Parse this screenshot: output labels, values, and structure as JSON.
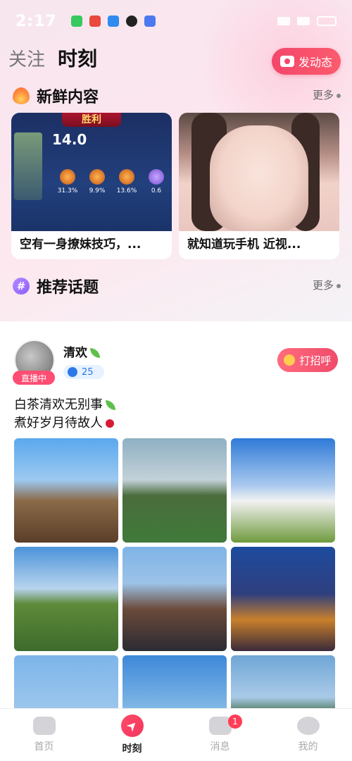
{
  "status_bar": {
    "time": "2:17"
  },
  "header": {
    "tabs": [
      {
        "label": "关注"
      },
      {
        "label": "时刻"
      }
    ],
    "post_button_label": "发动态"
  },
  "fresh_section": {
    "title": "新鲜内容",
    "more_label": "更多",
    "cards": [
      {
        "caption": "空有一身撩妹技巧，...",
        "game_banner": "胜利",
        "game_score": "14.0",
        "game_stats": [
          "31.3%",
          "9.9%",
          "13.6%",
          "0.6"
        ]
      },
      {
        "caption": "就知道玩手机 近视..."
      }
    ]
  },
  "topics_section": {
    "title": "推荐话题",
    "more_label": "更多"
  },
  "post": {
    "username": "清欢",
    "live_label": "直播中",
    "age": "25",
    "greet_label": "打招呼",
    "text_line1": "白茶清欢无别事",
    "text_line2": "煮好岁月待故人"
  },
  "nav": {
    "items": [
      {
        "label": "首页",
        "icon": "game-controller-icon"
      },
      {
        "label": "时刻",
        "icon": "compass-icon"
      },
      {
        "label": "消息",
        "icon": "message-icon"
      },
      {
        "label": "我的",
        "icon": "profile-icon"
      }
    ],
    "message_badge": "1"
  },
  "colors": {
    "accent": "#f4466b",
    "male_blue": "#2d78e8",
    "live_pink": "#ff4d73"
  }
}
